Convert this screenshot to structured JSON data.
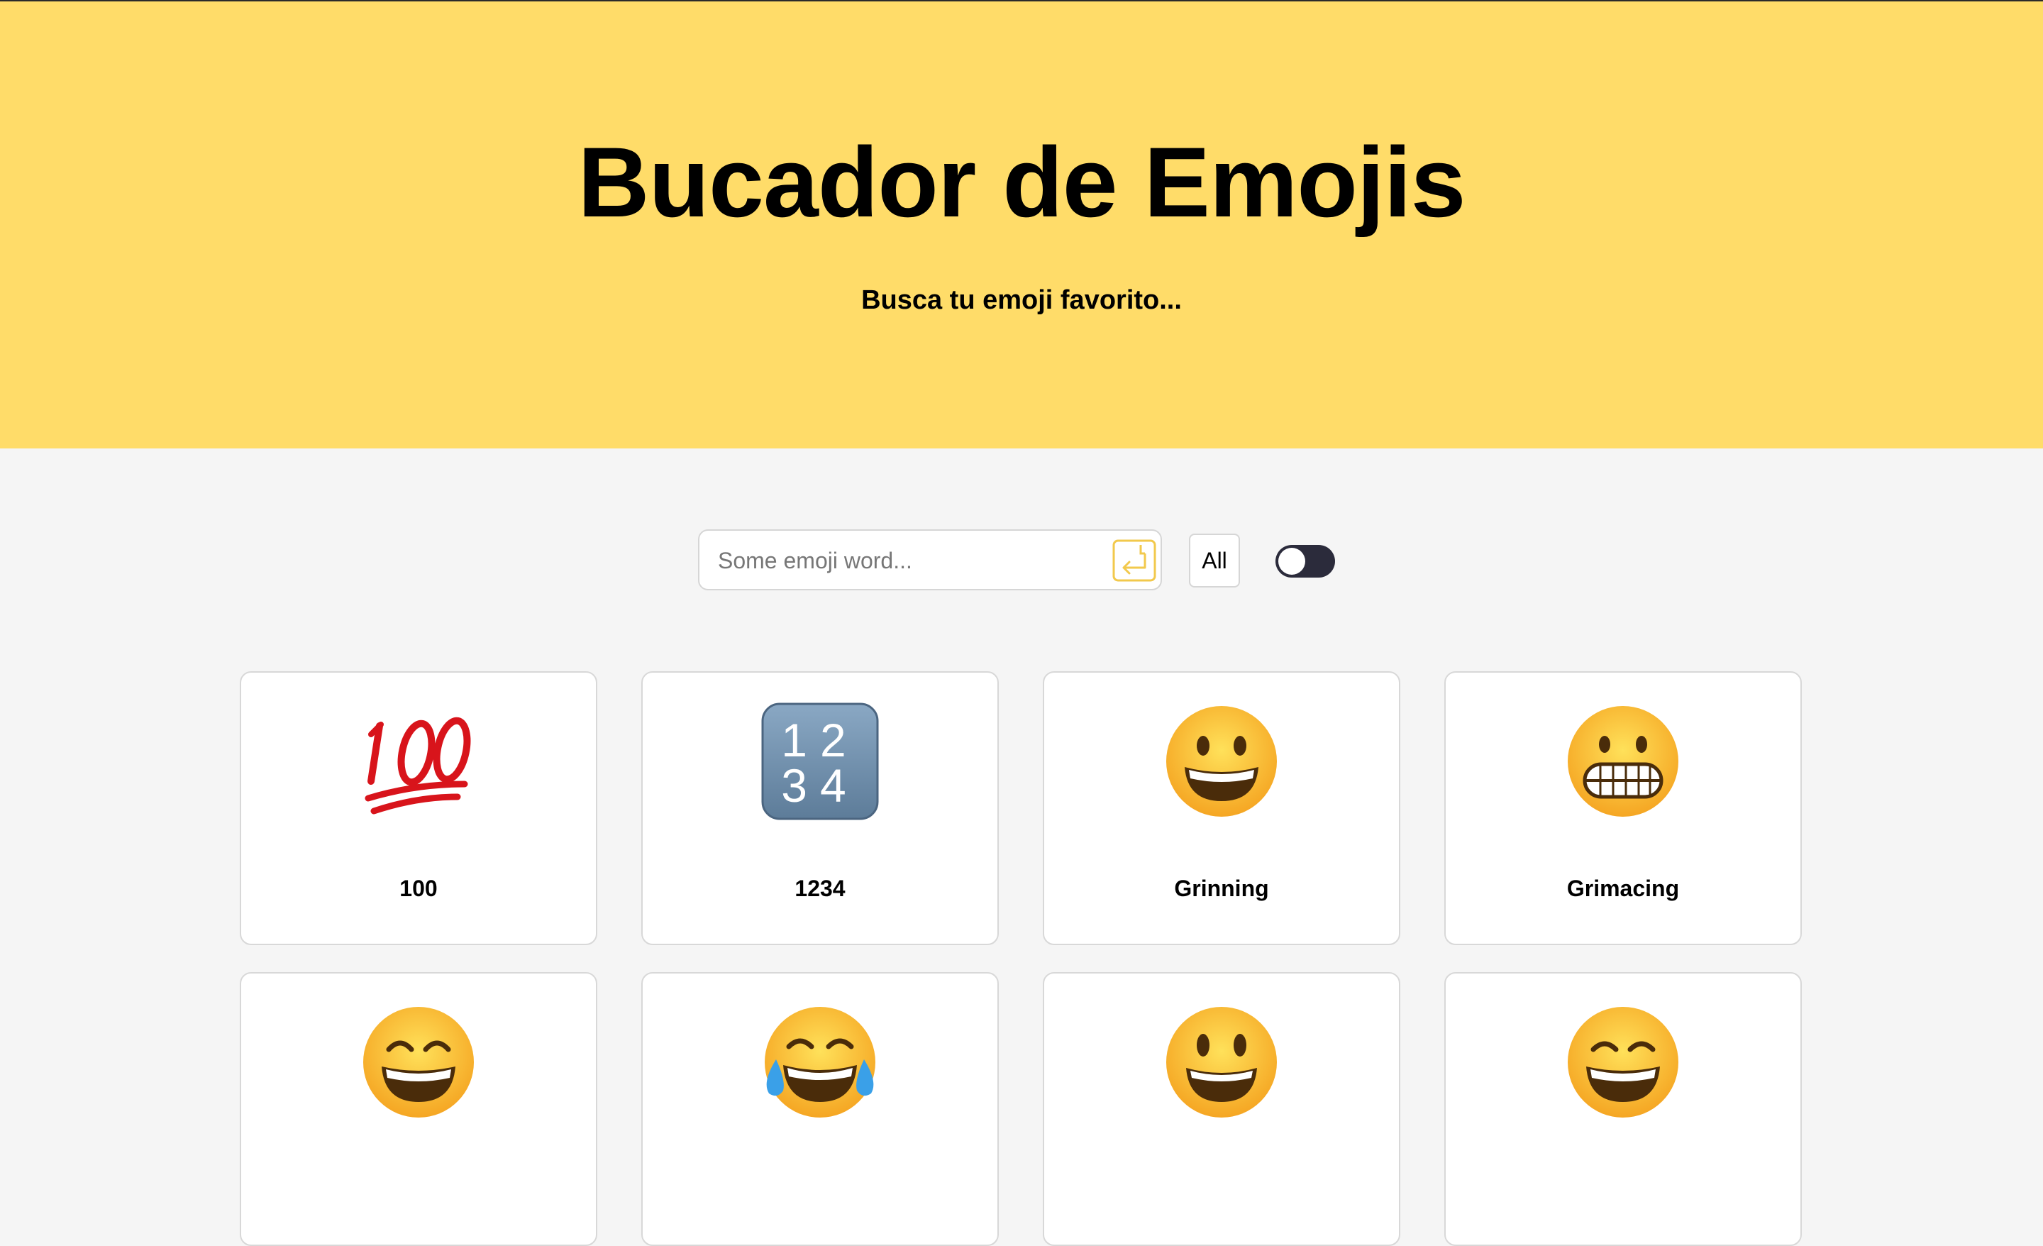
{
  "header": {
    "title": "Bucador de Emojis",
    "subtitle": "Busca tu emoji favorito..."
  },
  "search": {
    "placeholder": "Some emoji word...",
    "value": "",
    "enter_icon": "enter-return-icon"
  },
  "filter": {
    "label": "All"
  },
  "theme_toggle": {
    "state": "off"
  },
  "emojis": [
    {
      "label": "100",
      "icon": "hundred-points-icon"
    },
    {
      "label": "1234",
      "icon": "input-numbers-icon"
    },
    {
      "label": "Grinning",
      "icon": "grinning-face-icon"
    },
    {
      "label": "Grimacing",
      "icon": "grimacing-face-icon"
    },
    {
      "label": "",
      "icon": "grinning-squinting-face-icon"
    },
    {
      "label": "",
      "icon": "tears-of-joy-face-icon"
    },
    {
      "label": "",
      "icon": "smiley-face-icon"
    },
    {
      "label": "",
      "icon": "smile-face-icon"
    }
  ],
  "colors": {
    "hero_bg": "#ffdc69",
    "page_bg": "#f5f5f5",
    "accent": "#f2c94c",
    "toggle_bg": "#2b2b3b"
  }
}
